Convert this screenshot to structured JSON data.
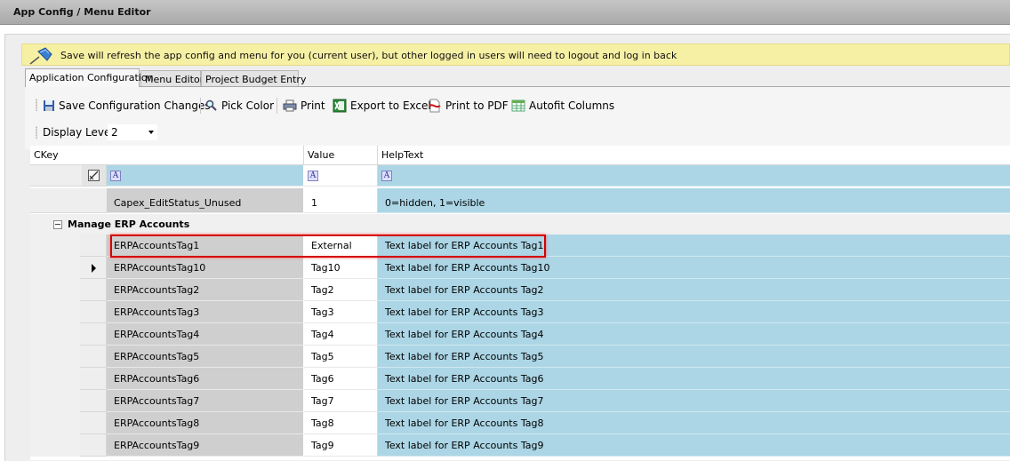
{
  "window": {
    "title": "App Config / Menu Editor"
  },
  "notice": {
    "text": "Save will refresh the app config and menu for you (current user), but other logged in users will need to logout and log in back"
  },
  "tabs": [
    {
      "label": "Application Configuration",
      "active": true
    },
    {
      "label": "Menu Editor",
      "active": false
    },
    {
      "label": "Project Budget Entry",
      "active": false
    }
  ],
  "toolbar": {
    "save": "Save Configuration Changes",
    "pick_color": "Pick Color",
    "print": "Print",
    "export_excel": "Export to Excel",
    "print_pdf": "Print to PDF",
    "autofit": "Autofit Columns"
  },
  "display_level": {
    "label": "Display Level",
    "value": "2"
  },
  "grid": {
    "columns": [
      "CKey",
      "Value",
      "HelpText"
    ],
    "filter_icon": "A",
    "top_rows": [
      {
        "ckey": "Capex_EditStatus_Unused",
        "value": "1",
        "help": "0=hidden, 1=visible"
      }
    ],
    "group": {
      "title": "Manage ERP Accounts",
      "rows": [
        {
          "ckey": "ERPAccountsTag1",
          "value": "External",
          "help": "Text label for ERP Accounts Tag1"
        },
        {
          "ckey": "ERPAccountsTag10",
          "value": "Tag10",
          "help": "Text label for ERP Accounts Tag10"
        },
        {
          "ckey": "ERPAccountsTag2",
          "value": "Tag2",
          "help": "Text label for ERP Accounts Tag2"
        },
        {
          "ckey": "ERPAccountsTag3",
          "value": "Tag3",
          "help": "Text label for ERP Accounts Tag3"
        },
        {
          "ckey": "ERPAccountsTag4",
          "value": "Tag4",
          "help": "Text label for ERP Accounts Tag4"
        },
        {
          "ckey": "ERPAccountsTag5",
          "value": "Tag5",
          "help": "Text label for ERP Accounts Tag5"
        },
        {
          "ckey": "ERPAccountsTag6",
          "value": "Tag6",
          "help": "Text label for ERP Accounts Tag6"
        },
        {
          "ckey": "ERPAccountsTag7",
          "value": "Tag7",
          "help": "Text label for ERP Accounts Tag7"
        },
        {
          "ckey": "ERPAccountsTag8",
          "value": "Tag8",
          "help": "Text label for ERP Accounts Tag8"
        },
        {
          "ckey": "ERPAccountsTag9",
          "value": "Tag9",
          "help": "Text label for ERP Accounts Tag9"
        }
      ]
    }
  }
}
